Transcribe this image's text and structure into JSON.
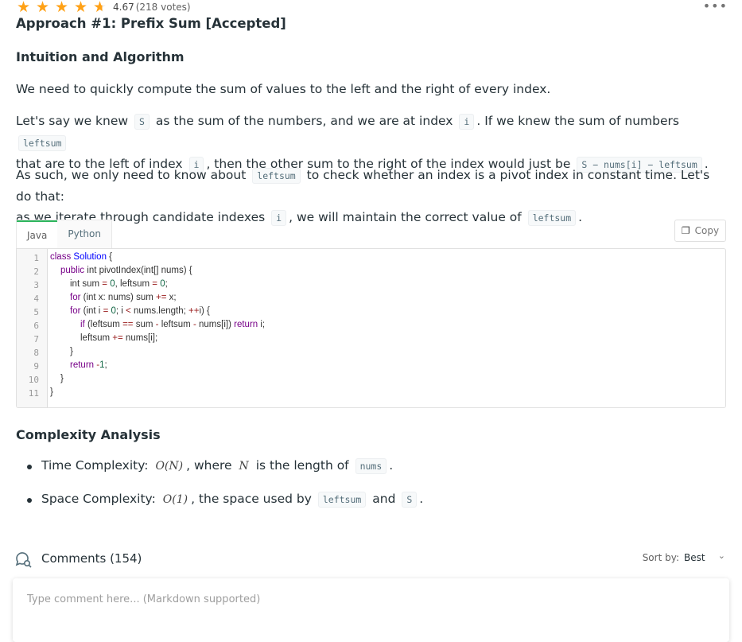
{
  "rating": {
    "value": "4.67",
    "votes": "(218 votes)",
    "stars": 4.67
  },
  "title": "Approach #1: Prefix Sum [Accepted]",
  "section1": "Intuition and Algorithm",
  "p1": "We need to quickly compute the sum of values to the left and the right of every index.",
  "p2": {
    "a": "Let's say we knew",
    "c1": "S",
    "b": "as the sum of the numbers, and we are at index",
    "c2": "i",
    "c": ". If we knew the sum of numbers",
    "c3": "leftsum",
    "d": "that are to the left of index",
    "c4": "i",
    "e": ", then the other sum to the right of the index would just be",
    "c5": "S − nums[i] − leftsum",
    "f": "."
  },
  "p3": {
    "a": "As such, we only need to know about",
    "c1": "leftsum",
    "b": "to check whether an index is a pivot index in constant time. Let's do that:",
    "d": "as we iterate through candidate indexes",
    "c2": "i",
    "e": ", we will maintain the correct value of",
    "c3": "leftsum",
    "f": "."
  },
  "tabs": [
    "Java",
    "Python"
  ],
  "copy_label": "Copy",
  "code_lines": [
    "1",
    "2",
    "3",
    "4",
    "5",
    "6",
    "7",
    "8",
    "9",
    "10",
    "11"
  ],
  "code": {
    "l1": [
      "class",
      "Solution",
      "{"
    ],
    "l2": [
      "public",
      "int",
      "pivotIndex(int[] nums) {"
    ],
    "l3": [
      "int sum",
      "=",
      "0",
      ", leftsum",
      "=",
      "0",
      ";"
    ],
    "l4": [
      "for",
      "(int x: nums) sum",
      "+=",
      "x;"
    ],
    "l5": [
      "for",
      "(int i",
      "=",
      "0",
      "; i",
      "<",
      "nums.length;",
      "++",
      "i) {"
    ],
    "l6": [
      "if",
      "(leftsum",
      "==",
      "sum",
      "-",
      "leftsum",
      "-",
      "nums[i])",
      "return",
      "i;"
    ],
    "l7": [
      "leftsum",
      "+=",
      "nums[i];"
    ],
    "l8": [
      "}"
    ],
    "l9": [
      "return",
      "-",
      "1",
      ";"
    ],
    "l10": [
      "}"
    ],
    "l11": [
      "}"
    ]
  },
  "section2": "Complexity Analysis",
  "time": {
    "a": "Time Complexity:",
    "m1": "O(N)",
    "b": ", where",
    "m2": "N",
    "c": "is the length of",
    "c1": "nums",
    "d": "."
  },
  "space": {
    "a": "Space Complexity:",
    "m1": "O(1)",
    "b": ", the space used by",
    "c1": "leftsum",
    "c": "and",
    "c2": "S",
    "d": "."
  },
  "comments": {
    "title": "Comments (154)",
    "sort_label": "Sort by:",
    "sort_value": "Best",
    "placeholder": "Type comment here... (Markdown supported)"
  },
  "colors": {
    "star": "#ffa116",
    "tab_accent": "#2db55d"
  }
}
